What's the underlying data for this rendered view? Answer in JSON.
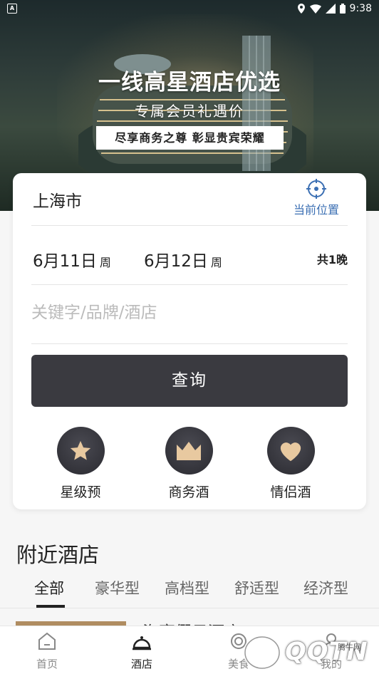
{
  "statusbar": {
    "time": "9:38",
    "app_icon": "A"
  },
  "hero": {
    "title": "一线高星酒店优选",
    "subtitle": "专属会员礼遇价",
    "badge": "尽享商务之尊 彰显贵宾荣耀"
  },
  "search": {
    "city": "上海市",
    "locate_label": "当前位置",
    "checkin_date": "6月11日",
    "checkin_weekday": "周",
    "checkout_date": "6月12日",
    "checkout_weekday": "周",
    "nights": "共1晚",
    "keyword_placeholder": "关键字/品牌/酒店",
    "query_button": "查询"
  },
  "categories": [
    {
      "label": "星级预",
      "icon": "star-icon"
    },
    {
      "label": "商务酒",
      "icon": "crown-icon"
    },
    {
      "label": "情侣酒",
      "icon": "heart-icon"
    }
  ],
  "nearby": {
    "title": "附近酒店",
    "filters": [
      "全部",
      "豪华型",
      "高档型",
      "舒适型",
      "经济型"
    ],
    "active_filter": "全部",
    "first_hotel_peek": "海享假日酒店"
  },
  "bottom_nav": [
    {
      "label": "首页",
      "icon": "home-icon"
    },
    {
      "label": "酒店",
      "icon": "hotel-bell-icon",
      "active": true
    },
    {
      "label": "美食",
      "icon": "food-icon"
    },
    {
      "label": "我的",
      "icon": "profile-icon"
    }
  ],
  "watermark": {
    "text": "QQTN",
    "small": "腾牛网"
  },
  "colors": {
    "accent_blue": "#3b6fb3",
    "button_dark": "#3a3a40",
    "icon_gold": "#e8c9a0"
  }
}
